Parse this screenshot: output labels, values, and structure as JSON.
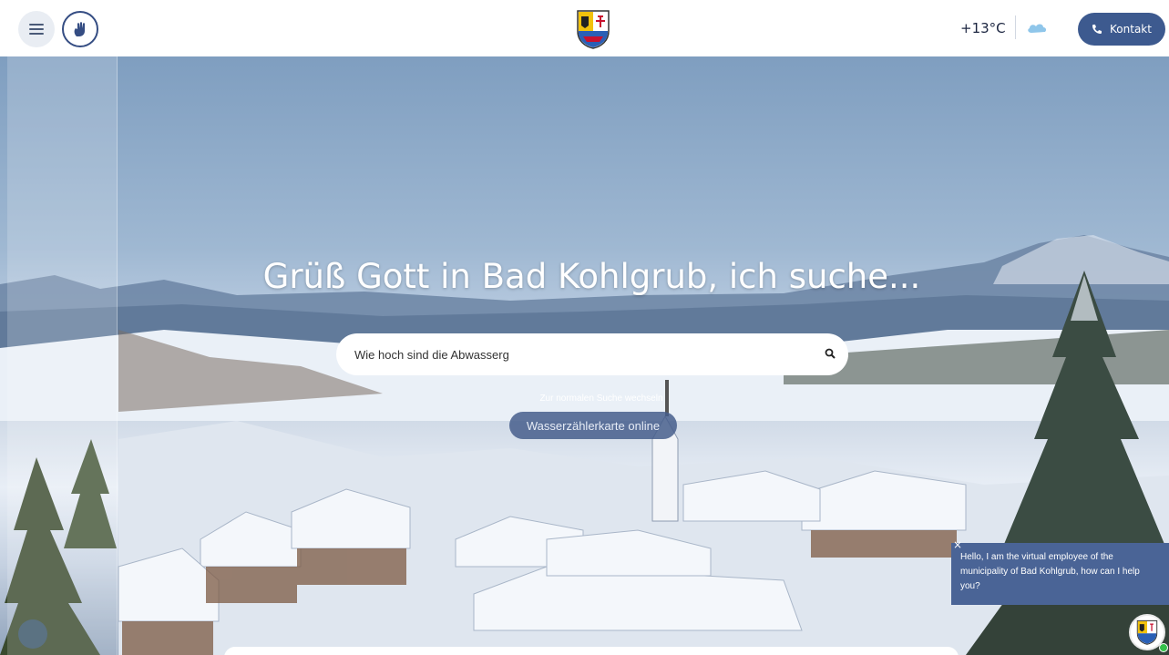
{
  "header": {
    "temperature": "+13°C",
    "contact_label": "Kontakt",
    "weather_icon": "cloud-icon",
    "menu_icon": "hamburger-icon",
    "accessibility_icon": "hand-icon",
    "logo_icon": "municipality-crest"
  },
  "hero": {
    "headline": "Grüß Gott in Bad Kohlgrub, ich suche...",
    "search": {
      "value": "Wie hoch sind die Abwasserg",
      "placeholder": ""
    },
    "switch_link": "Zur normalen Suche wechseln",
    "suggestion_button": "Wasserzählerkarte online"
  },
  "chat": {
    "close_label": "×",
    "message": "Hello, I am the virtual employee of the municipality of Bad Kohlgrub, how can I help you?"
  },
  "colors": {
    "accent": "#3d5a8f",
    "chat_bg": "#4a6496",
    "online": "#33c04a"
  }
}
